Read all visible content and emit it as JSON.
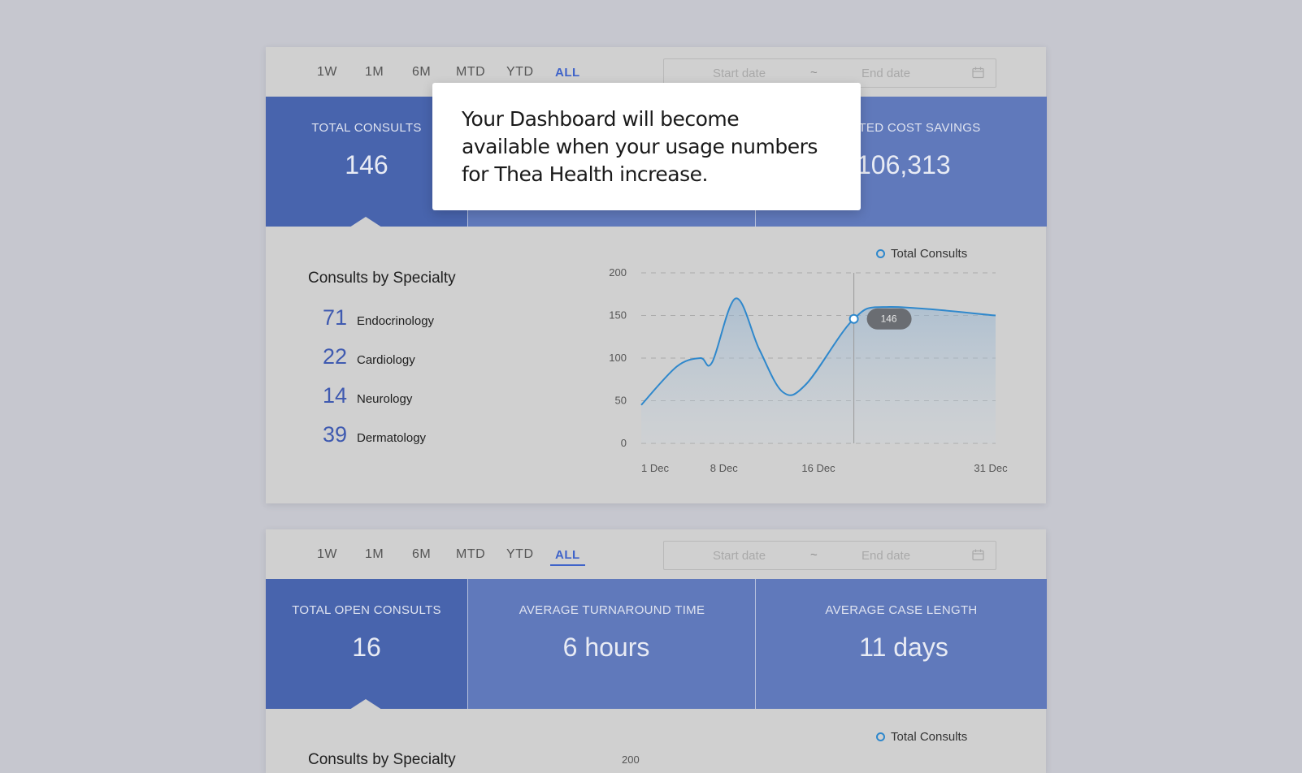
{
  "ranges": [
    "1W",
    "1M",
    "6M",
    "MTD",
    "YTD",
    "ALL"
  ],
  "date_picker": {
    "start_placeholder": "Start date",
    "separator": "~",
    "end_placeholder": "End date"
  },
  "panel1": {
    "kpis": [
      {
        "label": "TOTAL CONSULTS",
        "value": "146"
      },
      {
        "label": "",
        "value": ""
      },
      {
        "label": "IMATED COST SAVINGS",
        "value": "106,313"
      }
    ],
    "specialty": {
      "title": "Consults by Specialty",
      "items": [
        {
          "count": "71",
          "name": "Endocrinology"
        },
        {
          "count": "22",
          "name": "Cardiology"
        },
        {
          "count": "14",
          "name": "Neurology"
        },
        {
          "count": "39",
          "name": "Dermatology"
        }
      ]
    },
    "legend": "Total Consults"
  },
  "panel2": {
    "kpis": [
      {
        "label": "TOTAL OPEN CONSULTS",
        "value": "16"
      },
      {
        "label": "AVERAGE TURNAROUND TIME",
        "value": "6 hours"
      },
      {
        "label": "AVERAGE CASE LENGTH",
        "value": "11 days"
      }
    ],
    "specialty": {
      "title": "Consults by Specialty"
    },
    "legend": "Total Consults",
    "y_top": "200"
  },
  "modal": {
    "message": "Your Dashboard will become available when your usage numbers for Thea Health increase."
  },
  "colors": {
    "accent": "#3f63c9",
    "kpi_primary": "#4864ad",
    "kpi_secondary": "#6079bb",
    "line": "#2f88cc"
  },
  "chart_data": {
    "type": "area",
    "series": [
      {
        "name": "Total Consults",
        "values": [
          {
            "x": "1 Dec",
            "y": 45
          },
          {
            "x": "4 Dec",
            "y": 90
          },
          {
            "x": "6 Dec",
            "y": 100
          },
          {
            "x": "7 Dec",
            "y": 95
          },
          {
            "x": "9 Dec",
            "y": 170
          },
          {
            "x": "11 Dec",
            "y": 110
          },
          {
            "x": "13 Dec",
            "y": 60
          },
          {
            "x": "15 Dec",
            "y": 70
          },
          {
            "x": "19 Dec",
            "y": 146
          },
          {
            "x": "22 Dec",
            "y": 160
          },
          {
            "x": "31 Dec",
            "y": 150
          }
        ]
      }
    ],
    "x_ticks": [
      "1 Dec",
      "8 Dec",
      "16 Dec",
      "31 Dec"
    ],
    "y_ticks": [
      "200",
      "150",
      "100",
      "50",
      "0"
    ],
    "ylim": [
      0,
      200
    ],
    "tooltip": {
      "x": "19 Dec",
      "value": "146"
    },
    "grid": true,
    "legend_position": "top-right"
  }
}
